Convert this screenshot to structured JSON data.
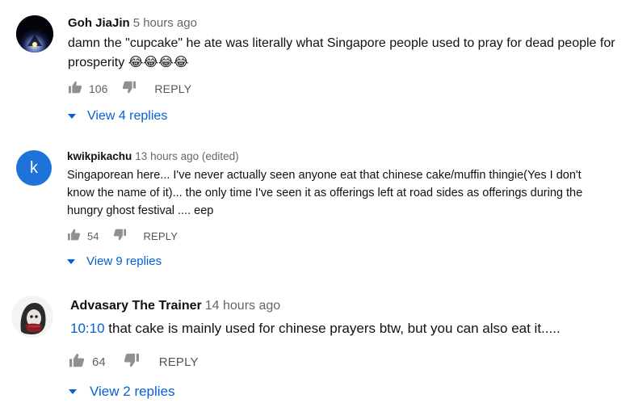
{
  "comments": [
    {
      "author": "Goh JiaJin",
      "time": "5 hours ago",
      "text_line1": "damn the \"cupcake\" he ate was literally what Singapore people used to pray for dead people for",
      "text_line2": "prosperity 😂😂😂😂",
      "likes": "106",
      "reply_label": "REPLY",
      "view_replies": "View 4 replies",
      "avatar_icon": "night-sky-avatar-icon"
    },
    {
      "author": "kwikpikachu",
      "time": "13 hours ago (edited)",
      "avatar_letter": "k",
      "text_line1": "Singaporean here... I've never actually seen anyone eat that chinese cake/muffin thingie(Yes I don't",
      "text_line2": "know the name of it)... the only time I've seen it as offerings left at road sides as offerings during the",
      "text_line3": "hungry ghost festival .... eep",
      "likes": "54",
      "reply_label": "REPLY",
      "view_replies": "View 9 replies",
      "avatar_color": "#1e73d8"
    },
    {
      "author": "Advasary The Trainer",
      "time": "14 hours ago",
      "timestamp_link": "10:10",
      "text_rest": " that cake is mainly used for chinese prayers btw, but you can also eat it.....",
      "likes": "64",
      "reply_label": "REPLY",
      "view_replies": "View 2 replies",
      "avatar_icon": "masked-character-avatar-icon"
    }
  ],
  "colors": {
    "link_blue": "#065fd4",
    "avatar_k_blue": "#1e73d8",
    "meta_gray": "#666666"
  }
}
